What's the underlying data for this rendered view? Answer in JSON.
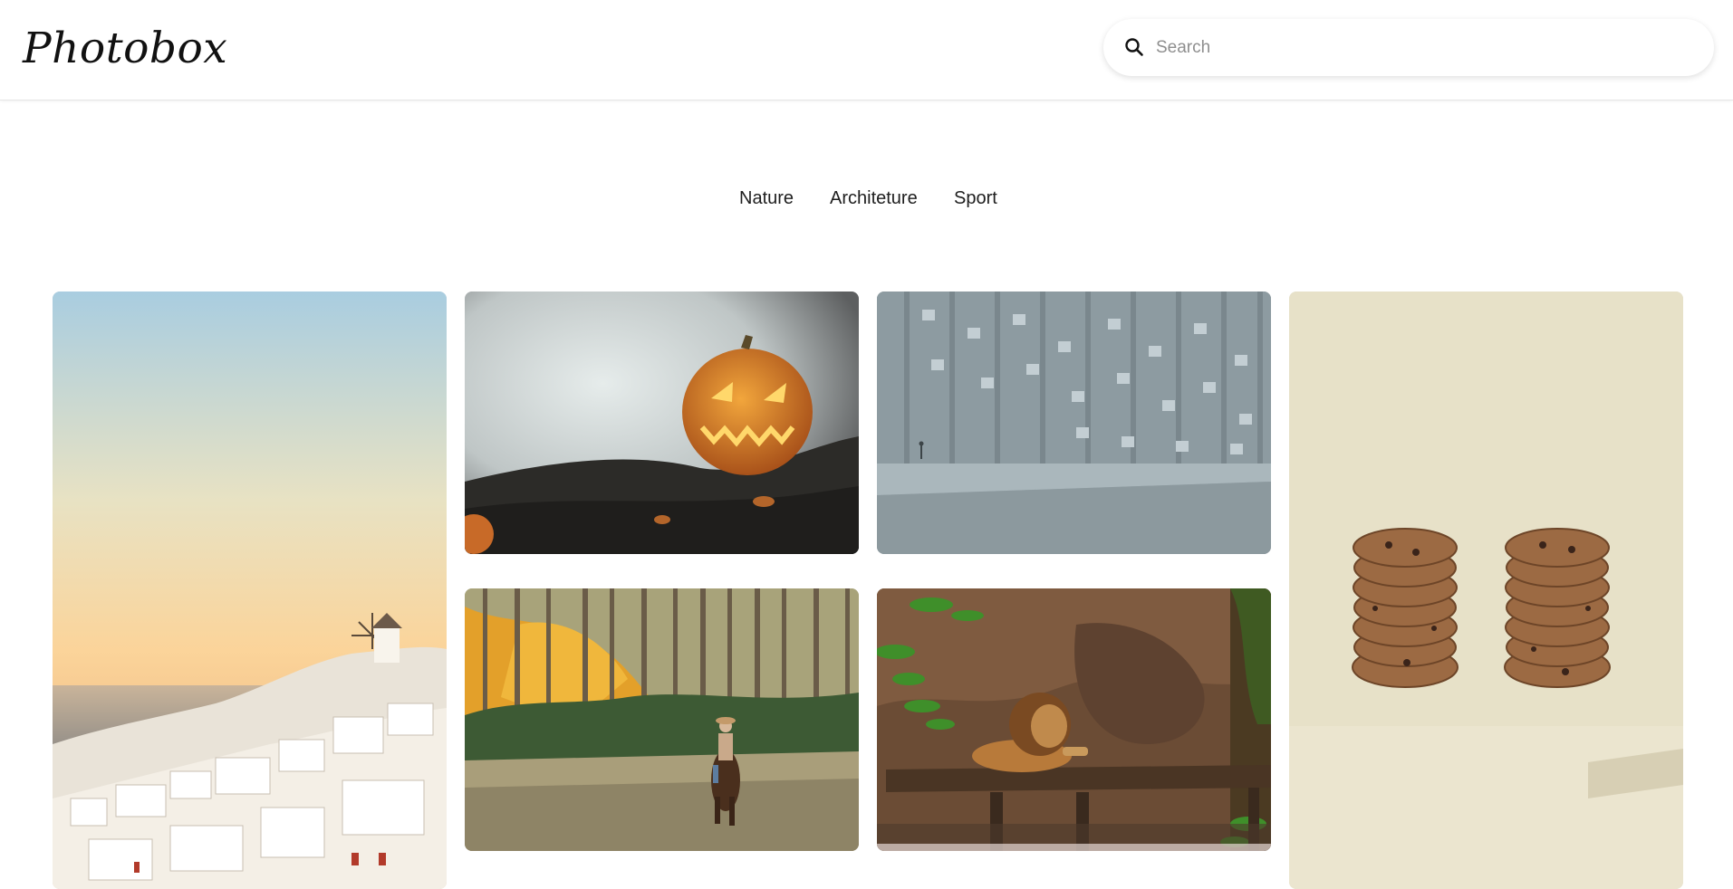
{
  "header": {
    "logo": "Photobox",
    "search": {
      "placeholder": "Search",
      "value": ""
    }
  },
  "categories": [
    {
      "label": "Nature"
    },
    {
      "label": "Architeture"
    },
    {
      "label": "Sport"
    }
  ],
  "gallery": {
    "photos": [
      {
        "subject": "santorini-sunset"
      },
      {
        "subject": "halloween-pumpkin-in-smoke"
      },
      {
        "subject": "modern-grey-building-facade"
      },
      {
        "subject": "cookie-stacks"
      },
      {
        "subject": "rider-on-horse-in-forest"
      },
      {
        "subject": "lion-resting-on-rock"
      }
    ]
  }
}
